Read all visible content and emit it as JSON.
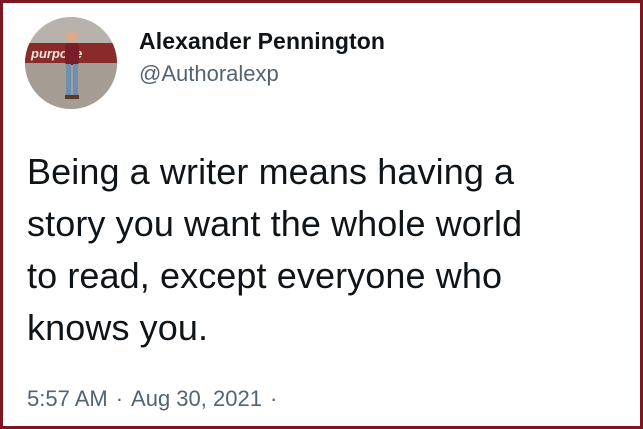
{
  "author": {
    "display_name": "Alexander Pennington",
    "handle": "@Authoralexp",
    "avatar_icon": "profile-photo",
    "avatar_sign_text": "purpose"
  },
  "tweet": {
    "text": "Being a writer means having a\nstory you want the whole world\nto read, except everyone who\nknows you."
  },
  "meta": {
    "time": "5:57 AM",
    "separator": "·",
    "date": "Aug 30, 2021",
    "trailing_separator": "·"
  },
  "colors": {
    "frame_border": "#7c1622",
    "text_primary": "#0f1419",
    "text_secondary": "#536471"
  }
}
